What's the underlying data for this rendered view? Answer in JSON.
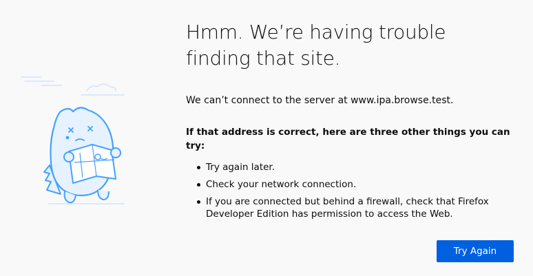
{
  "error_page": {
    "title_line1": "Hmm. We’re having trouble",
    "title_line2": "finding that site.",
    "description": "We can’t connect to the server at www.ipa.browse.test.",
    "advice_heading": "If that address is correct, here are three other things you can try:",
    "advice_items": [
      "Try again later.",
      "Check your network connection.",
      "If you are connected but behind a firewall, check that Firefox Developer Edition has permission to access the Web."
    ],
    "try_again_label": "Try Again"
  },
  "colors": {
    "background": "#f9f9fa",
    "primary_button": "#0060df",
    "illustration_stroke": "#45a1ff",
    "illustration_fill": "#e6f2ff"
  },
  "icons": {
    "illustration": "confused-dino-with-map-icon"
  }
}
